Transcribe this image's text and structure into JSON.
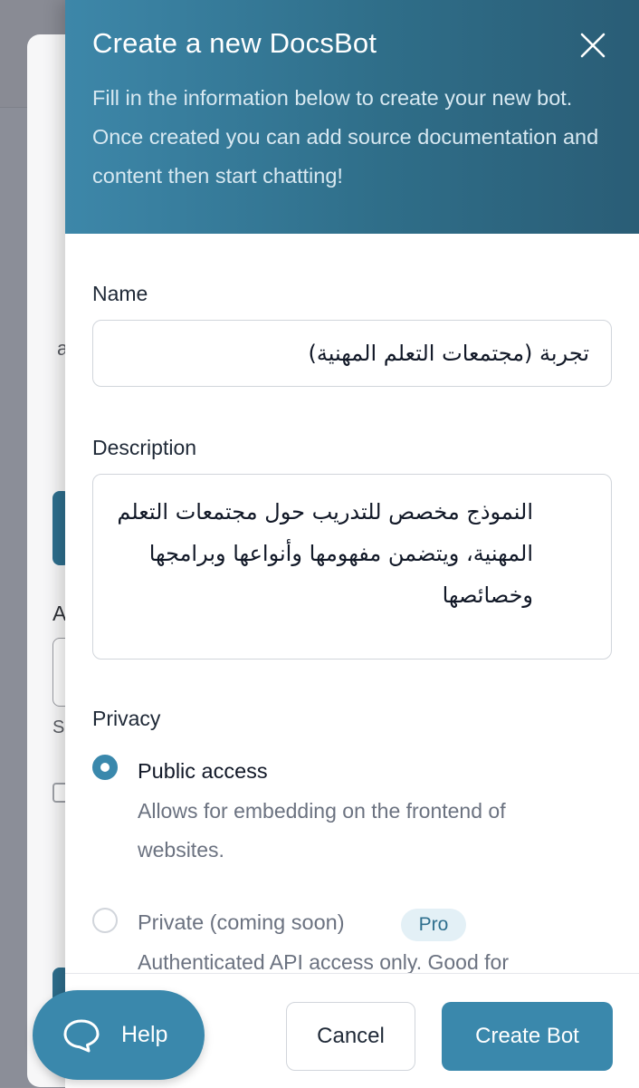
{
  "background": {
    "letters": [
      "a",
      "A",
      "S"
    ]
  },
  "modal": {
    "title": "Create a new DocsBot",
    "subtitle": "Fill in the information below to create your new bot. Once created you can add source documentation and content then start chatting!",
    "close_icon": "x-icon"
  },
  "form": {
    "name_label": "Name",
    "name_value": "تجربة (مجتمعات التعلم المهنية)",
    "description_label": "Description",
    "description_value": "النموذج مخصص للتدريب حول مجتمعات التعلم المهنية، ويتضمن مفهومها وأنواعها وبرامجها وخصائصها",
    "privacy_label": "Privacy",
    "options": [
      {
        "title": "Public access",
        "description": "Allows for embedding on the frontend of websites.",
        "selected": true
      },
      {
        "title": "Private (coming soon)",
        "badge": "Pro",
        "description": "Authenticated API access only. Good for",
        "selected": false
      }
    ]
  },
  "footer": {
    "cancel_label": "Cancel",
    "create_label": "Create Bot"
  },
  "help": {
    "label": "Help",
    "icon": "chat-bubble-icon"
  },
  "colors": {
    "accent": "#3a88ac",
    "header_dark": "#2a5d76",
    "badge_bg": "#e3f0f6"
  }
}
